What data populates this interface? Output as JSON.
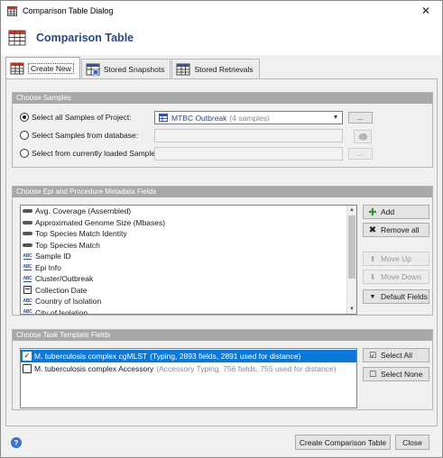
{
  "window": {
    "title": "Comparison Table Dialog",
    "close_glyph": "✕"
  },
  "header": {
    "heading": "Comparison Table"
  },
  "tabs": [
    {
      "label": "Create New",
      "icon": "table-icon",
      "active": true
    },
    {
      "label": "Stored Snapshots",
      "icon": "snapshot-table-icon",
      "active": false
    },
    {
      "label": "Stored Retrievals",
      "icon": "retrieval-table-icon",
      "active": false
    }
  ],
  "samples": {
    "header": "Choose Samples",
    "opt_project": "Select all Samples of Project:",
    "opt_database": "Select Samples from database:",
    "opt_loaded": "Select from currently loaded Samples:",
    "project_value": "MTBC Outbreak",
    "project_count": "(4 samples)",
    "ellipsis": "..."
  },
  "metadata": {
    "header": "Choose Epi and Procedure Metadata Fields",
    "items": [
      {
        "label": "Avg. Coverage (Assembled)",
        "icon": "numeric-field-icon"
      },
      {
        "label": "Approximated Genome Size (Mbases)",
        "icon": "numeric-field-icon"
      },
      {
        "label": "Top Species Match Identity",
        "icon": "numeric-field-icon"
      },
      {
        "label": "Top Species Match",
        "icon": "numeric-field-icon"
      },
      {
        "label": "Sample ID",
        "icon": "text-field-icon"
      },
      {
        "label": "Epi Info",
        "icon": "text-field-icon"
      },
      {
        "label": "Cluster/Outbreak",
        "icon": "text-field-icon"
      },
      {
        "label": "Collection Date",
        "icon": "date-field-icon"
      },
      {
        "label": "Country of Isolation",
        "icon": "text-field-icon"
      },
      {
        "label": "City of Isolation",
        "icon": "text-field-icon"
      }
    ],
    "abc": "ABC",
    "add": "Add",
    "remove_all": "Remove all",
    "move_up": "Move Up",
    "move_down": "Move Down",
    "default_fields": "Default Fields"
  },
  "templates": {
    "header": "Choose Task Template Fields",
    "items": [
      {
        "name": "M. tuberculosis complex cgMLST",
        "detail": "(Typing, 2893 fields, 2891 used for distance)",
        "checked": true,
        "selected": true
      },
      {
        "name": "M. tuberculosis complex Accessory",
        "detail": "(Accessory Typing, 756 fields, 755 used for distance)",
        "checked": false,
        "selected": false
      }
    ],
    "check_mark": "✓",
    "select_all": "Select All",
    "select_none": "Select None"
  },
  "footer": {
    "help": "?",
    "create": "Create Comparison Table",
    "close": "Close"
  },
  "colors": {
    "selection": "#0a78d7",
    "heading": "#2b4a7e",
    "group_header": "#a8a8a8"
  }
}
